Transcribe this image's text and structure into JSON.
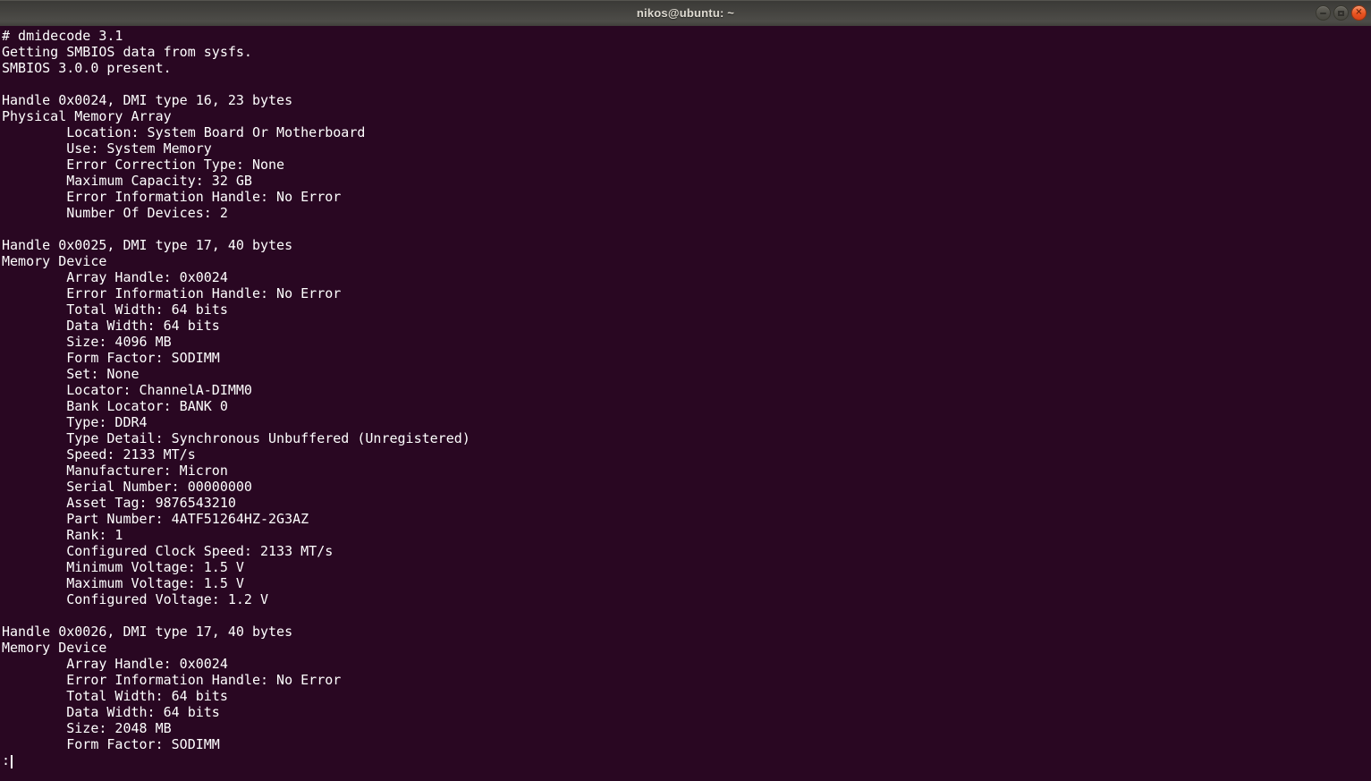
{
  "window": {
    "title": "nikos@ubuntu: ~",
    "controls": {
      "minimize_icon": "minus",
      "maximize_icon": "square",
      "close_glyph": "✕"
    }
  },
  "colors": {
    "terminal_bg": "#290722",
    "terminal_fg": "#FFFFFF",
    "titlebar_top": "#3A3936",
    "titlebar_bottom": "#4D4C48",
    "titlebar_text": "#DFDBD2",
    "close_button": "#E95420"
  },
  "terminal": {
    "lines": [
      "# dmidecode 3.1",
      "Getting SMBIOS data from sysfs.",
      "SMBIOS 3.0.0 present.",
      "",
      "Handle 0x0024, DMI type 16, 23 bytes",
      "Physical Memory Array",
      "        Location: System Board Or Motherboard",
      "        Use: System Memory",
      "        Error Correction Type: None",
      "        Maximum Capacity: 32 GB",
      "        Error Information Handle: No Error",
      "        Number Of Devices: 2",
      "",
      "Handle 0x0025, DMI type 17, 40 bytes",
      "Memory Device",
      "        Array Handle: 0x0024",
      "        Error Information Handle: No Error",
      "        Total Width: 64 bits",
      "        Data Width: 64 bits",
      "        Size: 4096 MB",
      "        Form Factor: SODIMM",
      "        Set: None",
      "        Locator: ChannelA-DIMM0",
      "        Bank Locator: BANK 0",
      "        Type: DDR4",
      "        Type Detail: Synchronous Unbuffered (Unregistered)",
      "        Speed: 2133 MT/s",
      "        Manufacturer: Micron",
      "        Serial Number: 00000000",
      "        Asset Tag: 9876543210",
      "        Part Number: 4ATF51264HZ-2G3AZ",
      "        Rank: 1",
      "        Configured Clock Speed: 2133 MT/s",
      "        Minimum Voltage: 1.5 V",
      "        Maximum Voltage: 1.5 V",
      "        Configured Voltage: 1.2 V",
      "",
      "Handle 0x0026, DMI type 17, 40 bytes",
      "Memory Device",
      "        Array Handle: 0x0024",
      "        Error Information Handle: No Error",
      "        Total Width: 64 bits",
      "        Data Width: 64 bits",
      "        Size: 2048 MB",
      "        Form Factor: SODIMM"
    ],
    "pager_prompt": ":"
  }
}
